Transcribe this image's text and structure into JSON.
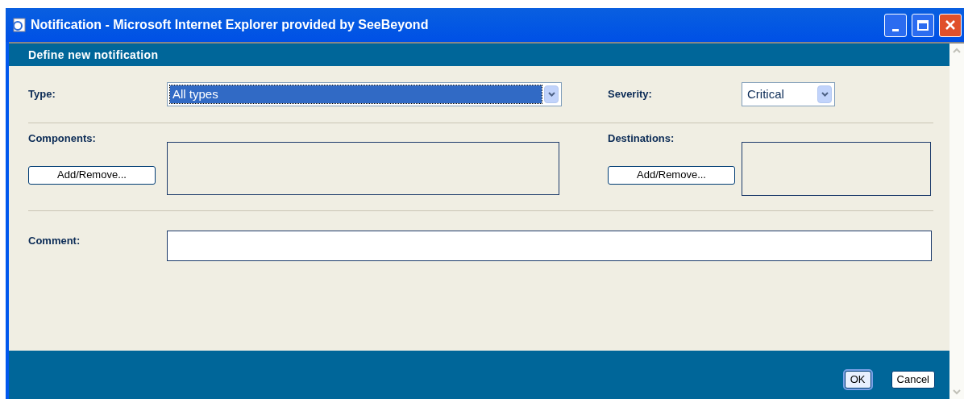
{
  "window": {
    "title": "Notification - Microsoft Internet Explorer provided by SeeBeyond"
  },
  "header": "Define new notification",
  "type": {
    "label": "Type:",
    "value": "All types",
    "focused": true
  },
  "severity": {
    "label": "Severity:",
    "value": "Critical"
  },
  "components": {
    "label": "Components:",
    "button": "Add/Remove..."
  },
  "destinations": {
    "label": "Destinations:",
    "button": "Add/Remove..."
  },
  "comment": {
    "label": "Comment:"
  },
  "buttons": [
    {
      "label": "OK",
      "focused": true
    },
    {
      "label": "Cancel",
      "focused": false
    }
  ]
}
